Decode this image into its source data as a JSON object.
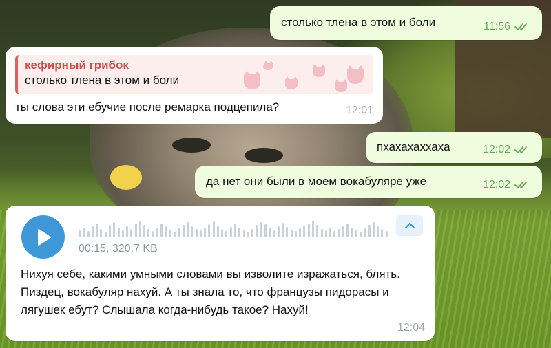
{
  "messages": [
    {
      "direction": "outgoing",
      "text": "столько тлена в этом и боли",
      "time": "11:56",
      "status": "read"
    },
    {
      "direction": "incoming",
      "reply_to": {
        "author": "кефирный грибок",
        "text": "столько тлена в этом и боли"
      },
      "text": "ты слова эти ебучие после ремарка подцепила?",
      "time": "12:01"
    },
    {
      "direction": "outgoing",
      "text": "пхахахаххаха",
      "time": "12:02",
      "status": "read"
    },
    {
      "direction": "outgoing",
      "text": "да нет они были в моем вокабуляре уже",
      "time": "12:02",
      "status": "read"
    },
    {
      "direction": "incoming",
      "type": "voice",
      "duration_size": "00:15, 320.7 KB",
      "transcript": "Нихуя себе, какими умными словами вы изволите изражаться, блять. Пиздец, вокабуляр нахуй. А ты знала то, что французы пидорасы и лягушек ебут? Слышала когда-нибудь такое? Нахуй!",
      "time": "12:04"
    }
  ],
  "colors": {
    "outgoing_bubble": "#effdde",
    "incoming_bubble": "#ffffff",
    "read_ticks": "#5fab56",
    "reply_accent": "#e35d5d",
    "play_button": "#3e98d8"
  },
  "icons": [
    "double-check-icon",
    "play-icon",
    "chevron-up-icon",
    "cat-pattern-icon"
  ]
}
